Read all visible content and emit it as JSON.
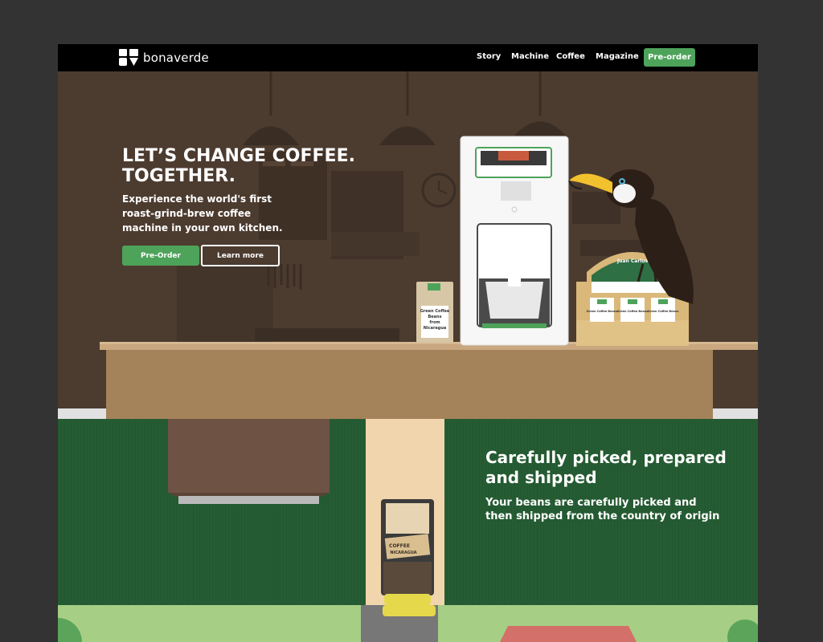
{
  "brand": {
    "name": "bonaverde"
  },
  "nav": {
    "links": [
      "Story",
      "Machine",
      "Coffee",
      "Magazine"
    ],
    "cta": "Pre-order"
  },
  "hero": {
    "title_line1": "LET’S CHANGE COFFEE.",
    "title_line2": "TOGETHER.",
    "subtitle": "Experience the world's first roast-grind-brew coffee machine in your own kitchen.",
    "primary_button": "Pre-Order",
    "secondary_button": "Learn more",
    "bag_label": [
      "Green Coffee",
      "Beans",
      "from",
      "Nicaragua"
    ],
    "crate_sign": "Juan Carlos",
    "crate_labels": [
      "Green Coffee Beans",
      "Green Coffee Beans",
      "Green Coffee Beans"
    ]
  },
  "section2": {
    "title": "Carefully picked, prepared and shipped",
    "subtitle": "Your beans are carefully picked and then shipped from the country of origin",
    "truck_sign": [
      "COFFEE",
      "NICARAGUA"
    ]
  },
  "colors": {
    "accent_green": "#4ea35a",
    "hero_bg": "#4c3b2f",
    "section2_bg": "#255c33",
    "page_bg": "#333333"
  }
}
